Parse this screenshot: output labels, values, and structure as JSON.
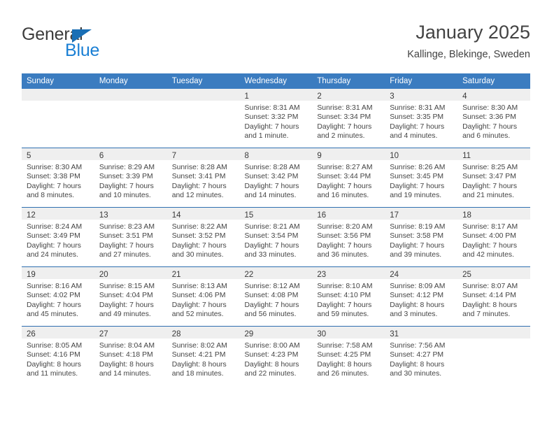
{
  "brand": {
    "name_part1": "General",
    "name_part2": "Blue",
    "colors": {
      "general": "#3c3c3c",
      "blue": "#1a7fd4",
      "triangle": "#1a6fb5"
    }
  },
  "header": {
    "title": "January 2025",
    "subtitle": "Kallinge, Blekinge, Sweden"
  },
  "theme": {
    "header_row_bg": "#3b7cc0",
    "header_row_text": "#ffffff",
    "daynum_band_bg": "#efefef",
    "week_separator": "#2f6fb0",
    "cell_bg": "#ffffff",
    "body_text": "#444444"
  },
  "weekday_headers": [
    "Sunday",
    "Monday",
    "Tuesday",
    "Wednesday",
    "Thursday",
    "Friday",
    "Saturday"
  ],
  "weeks": [
    [
      {
        "day": "",
        "lines": []
      },
      {
        "day": "",
        "lines": []
      },
      {
        "day": "",
        "lines": []
      },
      {
        "day": "1",
        "lines": [
          "Sunrise: 8:31 AM",
          "Sunset: 3:32 PM",
          "Daylight: 7 hours",
          "and 1 minute."
        ]
      },
      {
        "day": "2",
        "lines": [
          "Sunrise: 8:31 AM",
          "Sunset: 3:34 PM",
          "Daylight: 7 hours",
          "and 2 minutes."
        ]
      },
      {
        "day": "3",
        "lines": [
          "Sunrise: 8:31 AM",
          "Sunset: 3:35 PM",
          "Daylight: 7 hours",
          "and 4 minutes."
        ]
      },
      {
        "day": "4",
        "lines": [
          "Sunrise: 8:30 AM",
          "Sunset: 3:36 PM",
          "Daylight: 7 hours",
          "and 6 minutes."
        ]
      }
    ],
    [
      {
        "day": "5",
        "lines": [
          "Sunrise: 8:30 AM",
          "Sunset: 3:38 PM",
          "Daylight: 7 hours",
          "and 8 minutes."
        ]
      },
      {
        "day": "6",
        "lines": [
          "Sunrise: 8:29 AM",
          "Sunset: 3:39 PM",
          "Daylight: 7 hours",
          "and 10 minutes."
        ]
      },
      {
        "day": "7",
        "lines": [
          "Sunrise: 8:28 AM",
          "Sunset: 3:41 PM",
          "Daylight: 7 hours",
          "and 12 minutes."
        ]
      },
      {
        "day": "8",
        "lines": [
          "Sunrise: 8:28 AM",
          "Sunset: 3:42 PM",
          "Daylight: 7 hours",
          "and 14 minutes."
        ]
      },
      {
        "day": "9",
        "lines": [
          "Sunrise: 8:27 AM",
          "Sunset: 3:44 PM",
          "Daylight: 7 hours",
          "and 16 minutes."
        ]
      },
      {
        "day": "10",
        "lines": [
          "Sunrise: 8:26 AM",
          "Sunset: 3:45 PM",
          "Daylight: 7 hours",
          "and 19 minutes."
        ]
      },
      {
        "day": "11",
        "lines": [
          "Sunrise: 8:25 AM",
          "Sunset: 3:47 PM",
          "Daylight: 7 hours",
          "and 21 minutes."
        ]
      }
    ],
    [
      {
        "day": "12",
        "lines": [
          "Sunrise: 8:24 AM",
          "Sunset: 3:49 PM",
          "Daylight: 7 hours",
          "and 24 minutes."
        ]
      },
      {
        "day": "13",
        "lines": [
          "Sunrise: 8:23 AM",
          "Sunset: 3:51 PM",
          "Daylight: 7 hours",
          "and 27 minutes."
        ]
      },
      {
        "day": "14",
        "lines": [
          "Sunrise: 8:22 AM",
          "Sunset: 3:52 PM",
          "Daylight: 7 hours",
          "and 30 minutes."
        ]
      },
      {
        "day": "15",
        "lines": [
          "Sunrise: 8:21 AM",
          "Sunset: 3:54 PM",
          "Daylight: 7 hours",
          "and 33 minutes."
        ]
      },
      {
        "day": "16",
        "lines": [
          "Sunrise: 8:20 AM",
          "Sunset: 3:56 PM",
          "Daylight: 7 hours",
          "and 36 minutes."
        ]
      },
      {
        "day": "17",
        "lines": [
          "Sunrise: 8:19 AM",
          "Sunset: 3:58 PM",
          "Daylight: 7 hours",
          "and 39 minutes."
        ]
      },
      {
        "day": "18",
        "lines": [
          "Sunrise: 8:17 AM",
          "Sunset: 4:00 PM",
          "Daylight: 7 hours",
          "and 42 minutes."
        ]
      }
    ],
    [
      {
        "day": "19",
        "lines": [
          "Sunrise: 8:16 AM",
          "Sunset: 4:02 PM",
          "Daylight: 7 hours",
          "and 45 minutes."
        ]
      },
      {
        "day": "20",
        "lines": [
          "Sunrise: 8:15 AM",
          "Sunset: 4:04 PM",
          "Daylight: 7 hours",
          "and 49 minutes."
        ]
      },
      {
        "day": "21",
        "lines": [
          "Sunrise: 8:13 AM",
          "Sunset: 4:06 PM",
          "Daylight: 7 hours",
          "and 52 minutes."
        ]
      },
      {
        "day": "22",
        "lines": [
          "Sunrise: 8:12 AM",
          "Sunset: 4:08 PM",
          "Daylight: 7 hours",
          "and 56 minutes."
        ]
      },
      {
        "day": "23",
        "lines": [
          "Sunrise: 8:10 AM",
          "Sunset: 4:10 PM",
          "Daylight: 7 hours",
          "and 59 minutes."
        ]
      },
      {
        "day": "24",
        "lines": [
          "Sunrise: 8:09 AM",
          "Sunset: 4:12 PM",
          "Daylight: 8 hours",
          "and 3 minutes."
        ]
      },
      {
        "day": "25",
        "lines": [
          "Sunrise: 8:07 AM",
          "Sunset: 4:14 PM",
          "Daylight: 8 hours",
          "and 7 minutes."
        ]
      }
    ],
    [
      {
        "day": "26",
        "lines": [
          "Sunrise: 8:05 AM",
          "Sunset: 4:16 PM",
          "Daylight: 8 hours",
          "and 11 minutes."
        ]
      },
      {
        "day": "27",
        "lines": [
          "Sunrise: 8:04 AM",
          "Sunset: 4:18 PM",
          "Daylight: 8 hours",
          "and 14 minutes."
        ]
      },
      {
        "day": "28",
        "lines": [
          "Sunrise: 8:02 AM",
          "Sunset: 4:21 PM",
          "Daylight: 8 hours",
          "and 18 minutes."
        ]
      },
      {
        "day": "29",
        "lines": [
          "Sunrise: 8:00 AM",
          "Sunset: 4:23 PM",
          "Daylight: 8 hours",
          "and 22 minutes."
        ]
      },
      {
        "day": "30",
        "lines": [
          "Sunrise: 7:58 AM",
          "Sunset: 4:25 PM",
          "Daylight: 8 hours",
          "and 26 minutes."
        ]
      },
      {
        "day": "31",
        "lines": [
          "Sunrise: 7:56 AM",
          "Sunset: 4:27 PM",
          "Daylight: 8 hours",
          "and 30 minutes."
        ]
      },
      {
        "day": "",
        "lines": []
      }
    ]
  ]
}
